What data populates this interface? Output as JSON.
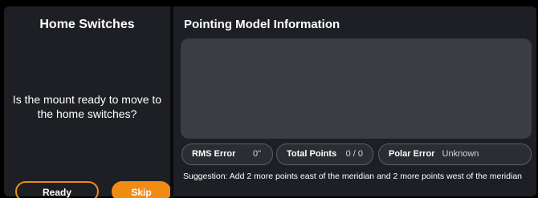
{
  "home_switches": {
    "title": "Home Switches",
    "question": "Is the mount ready to move to the home switches?",
    "ready_label": "Ready",
    "skip_label": "Skip"
  },
  "pointing_model": {
    "title": "Pointing Model Information",
    "rms_error": {
      "label": "RMS Error",
      "value": "0\""
    },
    "total_points": {
      "label": "Total Points",
      "value": "0 / 0"
    },
    "polar_error": {
      "label": "Polar Error",
      "value": "Unknown"
    },
    "suggestion": "Suggestion: Add 2 more points east of the meridian and 2 more points west of the meridian"
  },
  "colors": {
    "accent": "#f08c13",
    "panel": "#1d1f24",
    "info_box": "#3a3e43"
  }
}
